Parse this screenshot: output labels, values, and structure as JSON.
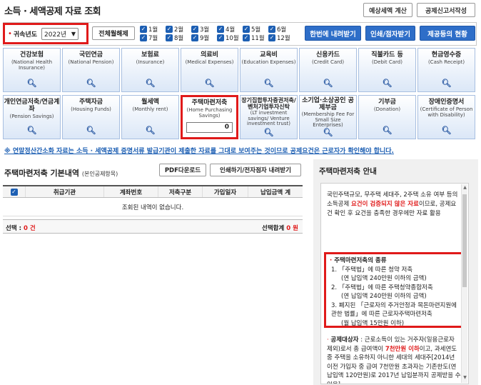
{
  "page_title": "소득 · 세액공제 자료 조회",
  "header_buttons": {
    "estimate": "예상세액 계산",
    "report": "공제신고서작성"
  },
  "filter": {
    "bullet": "•",
    "year_label": "귀속년도",
    "year_value": "2022년",
    "all_months": "전체월해제",
    "months_row1": [
      "1월",
      "2월",
      "3월",
      "4월",
      "5월",
      "6월"
    ],
    "months_row2": [
      "7월",
      "8월",
      "9월",
      "10월",
      "11월",
      "12월"
    ],
    "download_all": "한번에 내려받기",
    "print_view": "인쇄/점자받기",
    "status": "제공등의 현황"
  },
  "tiles_row1": [
    {
      "name": "건강보험",
      "en": "(National Health Insurance)"
    },
    {
      "name": "국민연금",
      "en": "(National Pension)"
    },
    {
      "name": "보험료",
      "en": "(Insurance)"
    },
    {
      "name": "의료비",
      "en": "(Medical Expenses)"
    },
    {
      "name": "교육비",
      "en": "(Education Expenses)"
    },
    {
      "name": "신용카드",
      "en": "(Credit Card)"
    },
    {
      "name": "직불카드 등",
      "en": "(Debit Card)"
    },
    {
      "name": "현금영수증",
      "en": "(Cash Receipt)"
    }
  ],
  "tiles_row2": [
    {
      "name": "개인연금저축/연금계좌",
      "en": "(Pension Savings)"
    },
    {
      "name": "주택자금",
      "en": "(Housing Funds)"
    },
    {
      "name": "월세액",
      "en": "(Monthly rent)"
    },
    {
      "name": "주택마련저축",
      "en": "(Home Purchasing Savings)",
      "amount": "0"
    },
    {
      "name": "장기집합투자증권저축/벤처기업투자신탁",
      "en": "(LT investment savings/ Venture investment trust)"
    },
    {
      "name": "소기업·소상공인 공제부금",
      "en": "(Membership Fee For Small Size Enterprises)"
    },
    {
      "name": "기부금",
      "en": "(Donation)"
    },
    {
      "name": "장애인증명서",
      "en": "(Certificate of Person with Disability)"
    }
  ],
  "notice": "※ 연말정산간소화 자료는 소득 · 세액공제 증명서류 발급기관이 제출한 자료를 그대로 보여주는 것이므로 공제요건은 근로자가 확인해야 합니다.",
  "section": {
    "title": "주택마련저축 기본내역",
    "subtitle": "(본인공제항목)",
    "pdf_button": "PDF다운로드",
    "print_button": "인쇄하기/전자점자 내려받기"
  },
  "grid": {
    "columns": [
      "취급기관",
      "계좌번호",
      "저축구분",
      "가입일자",
      "납입금액 계"
    ],
    "empty_message": "조회된 내역이 없습니다.",
    "selected_label": "선택 :",
    "selected_count": "0 건",
    "selected_total_label": "선택합계",
    "selected_total_value": "0 원"
  },
  "guide": {
    "title": "주택마련저축 안내",
    "intro_1": "국민주택규모, 무주택 세대주, 2주택 소유 여부 등의 소득공제 ",
    "intro_highlight": "요건이 검증되지 않은 자료",
    "intro_2": "이므로, 공제요건 확인 후 요건을 충족한 경우에만 자료 활용",
    "kinds_title": "주택마련저축의 종류",
    "kinds": [
      {
        "item": "1. 「주택법」에 따른 청약 저축",
        "sub": "(연 납입액 240만원 이하의 금액)"
      },
      {
        "item": "2. 「주택법」에 따른 주택청약종합저축",
        "sub": "(연 납입액 240만원 이하의 금액)"
      },
      {
        "item": "3. 폐지된 「근로자의 주거안정과 목돈마련지원에 관한 법률」에 따른 근로자주택마련저축",
        "sub": "(월 납입액 15만원 이하)"
      }
    ],
    "target_label": "공제대상자",
    "target_1": " : 근로소득이 있는 거주자(일용근로자 제외)로서 총 급여액이 ",
    "target_highlight": "7천만원 이하",
    "target_2": "이고, 과세연도 중 주택을 소유하지 아니한 세대의 세대주[2014년 이전 가입자 중 급여 7천만원 초과자는 기존한도(연 납입액 120만원)로 2017년 납입분까지 공제받을 수 있음]"
  },
  "icons": {
    "checkbox": "check-icon",
    "search": "search-icon"
  },
  "colors": {
    "highlight": "#e01a1a",
    "primary": "#2e6ec8",
    "link": "#1d5fb3"
  }
}
